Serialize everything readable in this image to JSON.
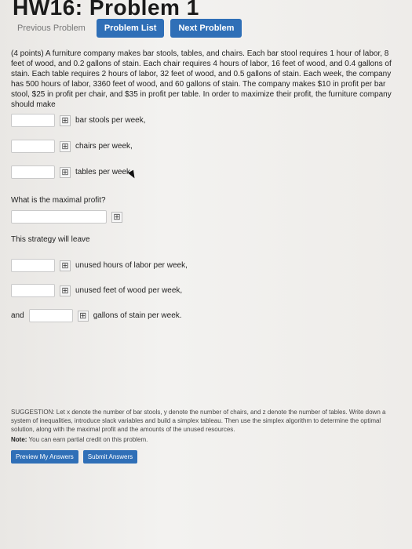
{
  "header": {
    "title": "HW16: Problem 1"
  },
  "nav": {
    "previous_label": "Previous Problem",
    "list_label": "Problem List",
    "next_label": "Next Problem"
  },
  "problem": {
    "statement": "(4 points) A furniture company makes bar stools, tables, and chairs. Each bar stool requires 1 hour of labor, 8 feet of wood, and 0.2 gallons of stain. Each chair requires 4 hours of labor, 16 feet of wood, and 0.4 gallons of stain. Each table requires 2 hours of labor, 32 feet of wood, and 0.5 gallons of stain. Each week, the company has 500 hours of labor, 3360 feet of wood, and 60 gallons of stain. The company makes $10 in profit per bar stool, $25 in profit per chair, and $35 in profit per table. In order to maximize their profit, the furniture company should make",
    "answers": [
      {
        "label": "bar stools per week,",
        "value": ""
      },
      {
        "label": "chairs per week,",
        "value": ""
      },
      {
        "label": "tables per week.",
        "value": ""
      }
    ],
    "profit_question": "What is the maximal profit?",
    "profit_value": "",
    "strategy_text": "This strategy will leave",
    "leftovers": [
      {
        "prefix": "",
        "label": "unused hours of labor per week,",
        "value": ""
      },
      {
        "prefix": "",
        "label": "unused feet of wood per week,",
        "value": ""
      },
      {
        "prefix": "and",
        "label": "gallons of stain per week.",
        "value": ""
      }
    ],
    "grid_icon": "⊞"
  },
  "suggestion": "SUGGESTION: Let x denote the number of bar stools, y denote the number of chairs, and z denote the number of tables. Write down a system of inequalities, introduce slack variables and build a simplex tableau. Then use the simplex algorithm to determine the optimal solution, along with the maximal profit and the amounts of the unused resources.",
  "note": {
    "bold": "Note:",
    "text": "You can earn partial credit on this problem."
  },
  "actions": {
    "preview_label": "Preview My Answers",
    "submit_label": "Submit Answers"
  },
  "colors": {
    "accent": "#2f6fb7"
  }
}
